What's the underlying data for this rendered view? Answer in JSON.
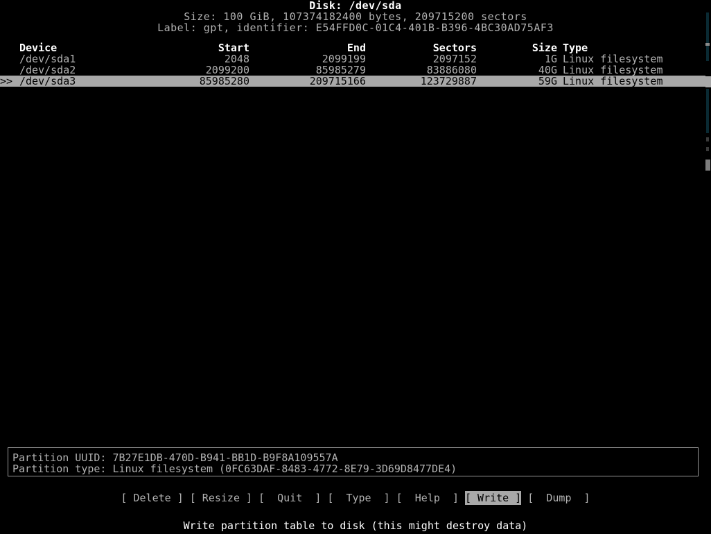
{
  "header": {
    "title": "Disk: /dev/sda",
    "size_line": "Size: 100 GiB, 107374182400 bytes, 209715200 sectors",
    "label_line": "Label: gpt, identifier: E54FFD0C-01C4-401B-B396-4BC30AD75AF3"
  },
  "table": {
    "columns": {
      "device": "Device",
      "start": "Start",
      "end": "End",
      "sectors": "Sectors",
      "size": "Size",
      "type": "Type"
    },
    "rows": [
      {
        "marker": "",
        "device": "/dev/sda1",
        "start": "2048",
        "end": "2099199",
        "sectors": "2097152",
        "size": "1G",
        "type": "Linux filesystem",
        "selected": false
      },
      {
        "marker": "",
        "device": "/dev/sda2",
        "start": "2099200",
        "end": "85985279",
        "sectors": "83886080",
        "size": "40G",
        "type": "Linux filesystem",
        "selected": false
      },
      {
        "marker": ">>",
        "device": "/dev/sda3",
        "start": "85985280",
        "end": "209715166",
        "sectors": "123729887",
        "size": "59G",
        "type": "Linux filesystem",
        "selected": true
      }
    ]
  },
  "info": {
    "uuid_line": "Partition UUID: 7B27E1DB-470D-B941-BB1D-B9F8A109557A",
    "type_line": "Partition type: Linux filesystem (0FC63DAF-8483-4772-8E79-3D69D8477DE4)"
  },
  "menu": {
    "items": [
      {
        "label": "Delete",
        "bracket_open": "[ ",
        "bracket_close": " ]",
        "active": false
      },
      {
        "label": "Resize",
        "bracket_open": "[ ",
        "bracket_close": " ]",
        "active": false
      },
      {
        "label": "Quit",
        "bracket_open": "[  ",
        "bracket_close": "  ]",
        "active": false
      },
      {
        "label": "Type",
        "bracket_open": "[  ",
        "bracket_close": "  ]",
        "active": false
      },
      {
        "label": "Help",
        "bracket_open": "[  ",
        "bracket_close": "  ]",
        "active": false
      },
      {
        "label": "Write",
        "bracket_open": "[ ",
        "bracket_close": " ]",
        "active": true
      },
      {
        "label": "Dump",
        "bracket_open": "[  ",
        "bracket_close": "  ]",
        "active": false
      }
    ]
  },
  "status": {
    "text": "Write partition table to disk (this might destroy data)"
  },
  "colors": {
    "background": "#000000",
    "foreground": "#b2b2b2",
    "bright": "#ffffff",
    "selection_bg": "#a8a8a8",
    "selection_fg": "#000000",
    "border": "#9a9a9a"
  }
}
